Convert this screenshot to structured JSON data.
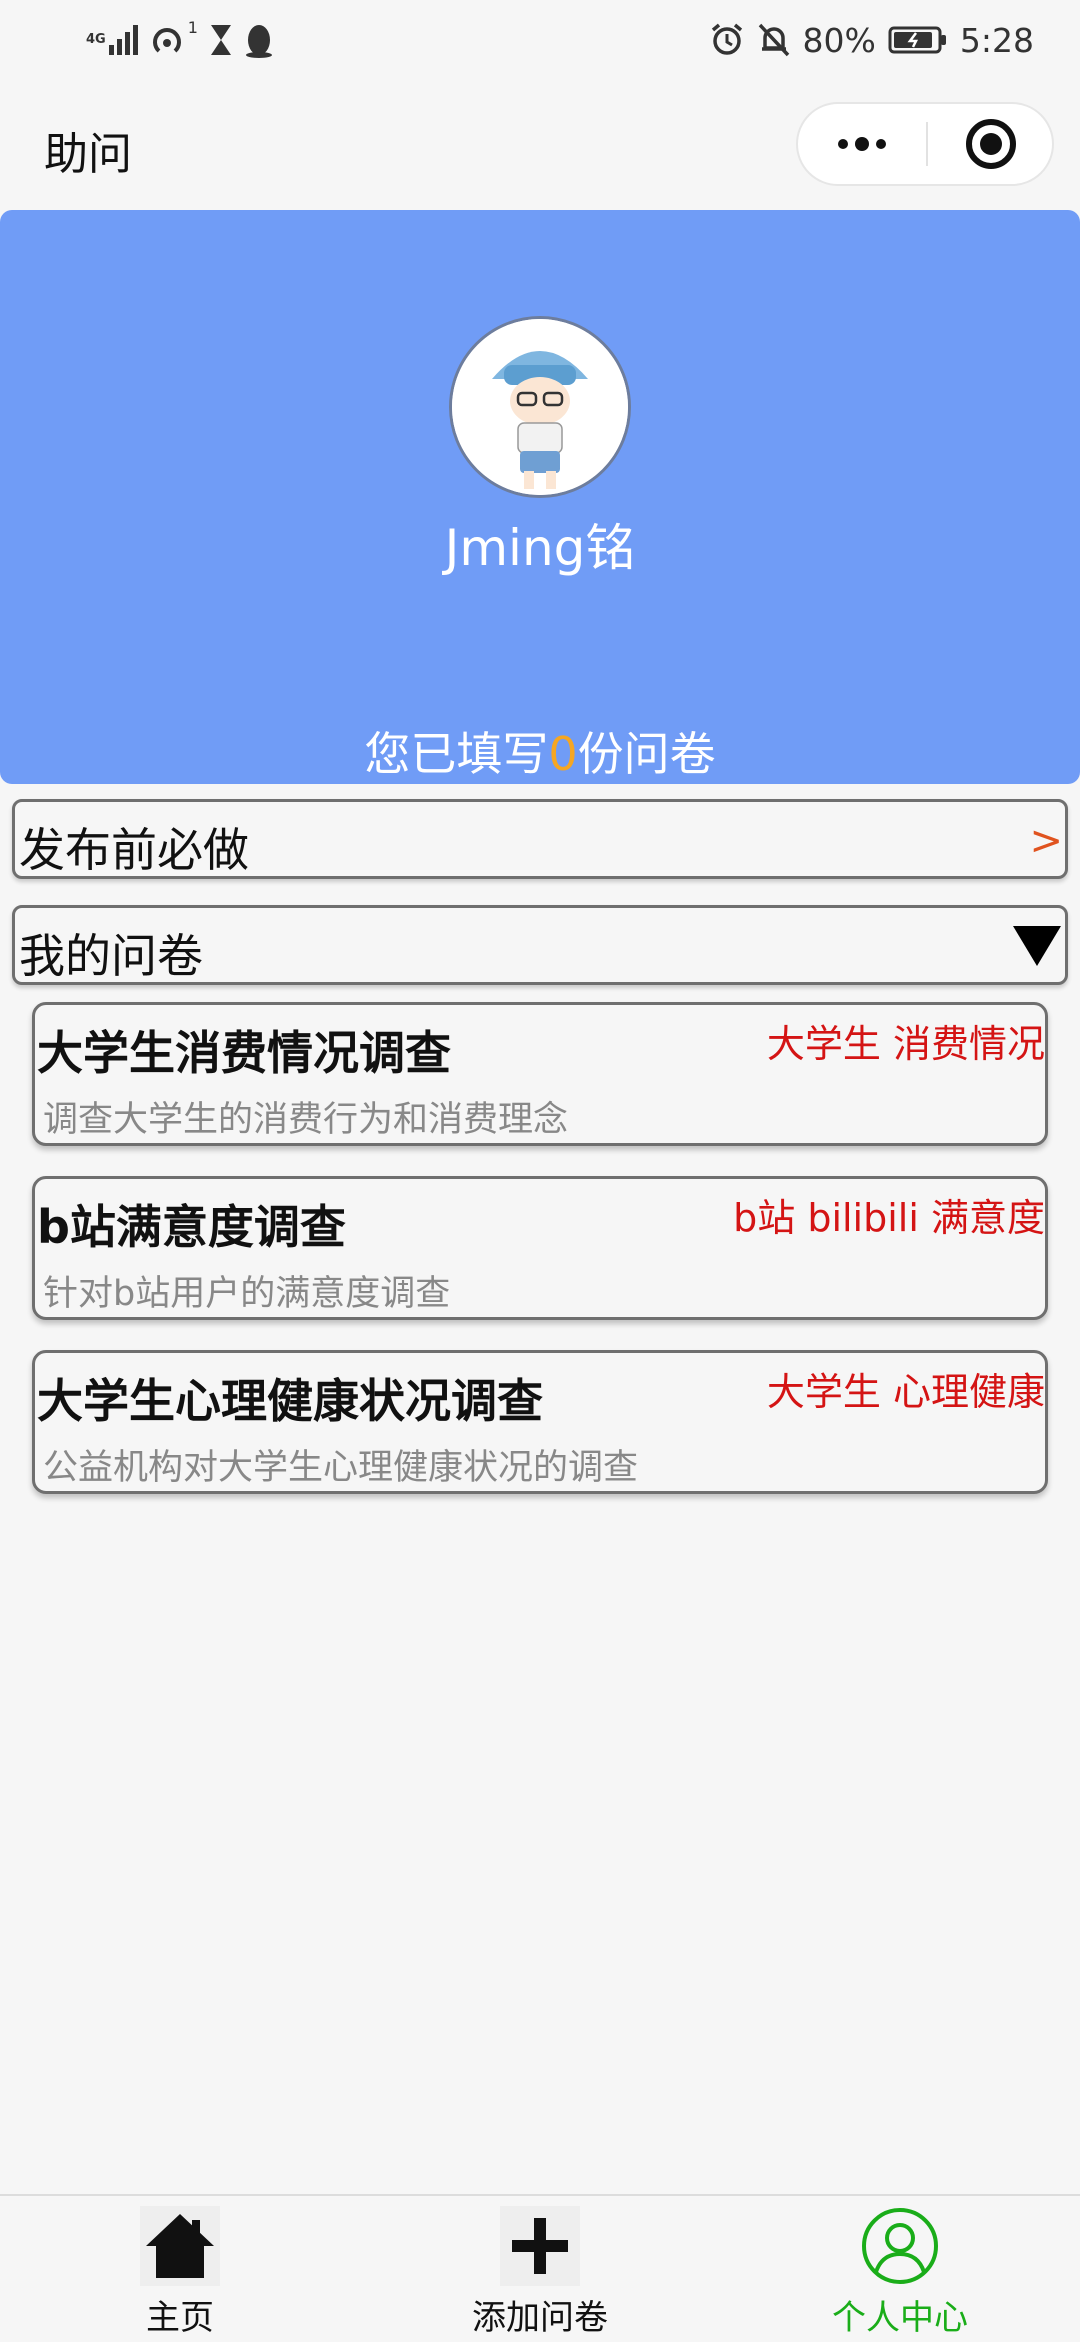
{
  "status_bar": {
    "network": "4G",
    "sim_number": "1",
    "battery": "80%",
    "time": "5:28"
  },
  "header": {
    "title": "助问"
  },
  "profile": {
    "username": "Jming铭",
    "filled_prefix": "您已填写",
    "filled_count": "0",
    "filled_suffix": "份问卷"
  },
  "sections": {
    "prepublish": {
      "label": "发布前必做",
      "arrow": ">"
    },
    "my_surveys": {
      "label": "我的问卷"
    }
  },
  "surveys": [
    {
      "title": "大学生消费情况调查",
      "tags": "大学生 消费情况",
      "desc": "调查大学生的消费行为和消费理念"
    },
    {
      "title": "b站满意度调查",
      "tags": "b站 bilibili 满意度",
      "desc": "针对b站用户的满意度调查"
    },
    {
      "title": "大学生心理健康状况调查",
      "tags": "大学生 心理健康",
      "desc": "公益机构对大学生心理健康状况的调查"
    }
  ],
  "tabbar": {
    "home": "主页",
    "add": "添加问卷",
    "profile": "个人中心"
  },
  "colors": {
    "header_bg": "#709cf6",
    "count_accent": "#f5a623",
    "tag_red": "#d41414",
    "arrow_orange": "#e0531f",
    "active_tab": "#1aad19"
  },
  "icons": [
    "signal-icon",
    "hotspot-icon",
    "hourglass-icon",
    "qq-penguin-icon",
    "alarm-icon",
    "mute-bell-icon",
    "battery-icon",
    "more-dots-icon",
    "close-circle-icon",
    "avatar-image",
    "home-icon",
    "plus-icon",
    "user-profile-icon",
    "dropdown-triangle-icon"
  ]
}
